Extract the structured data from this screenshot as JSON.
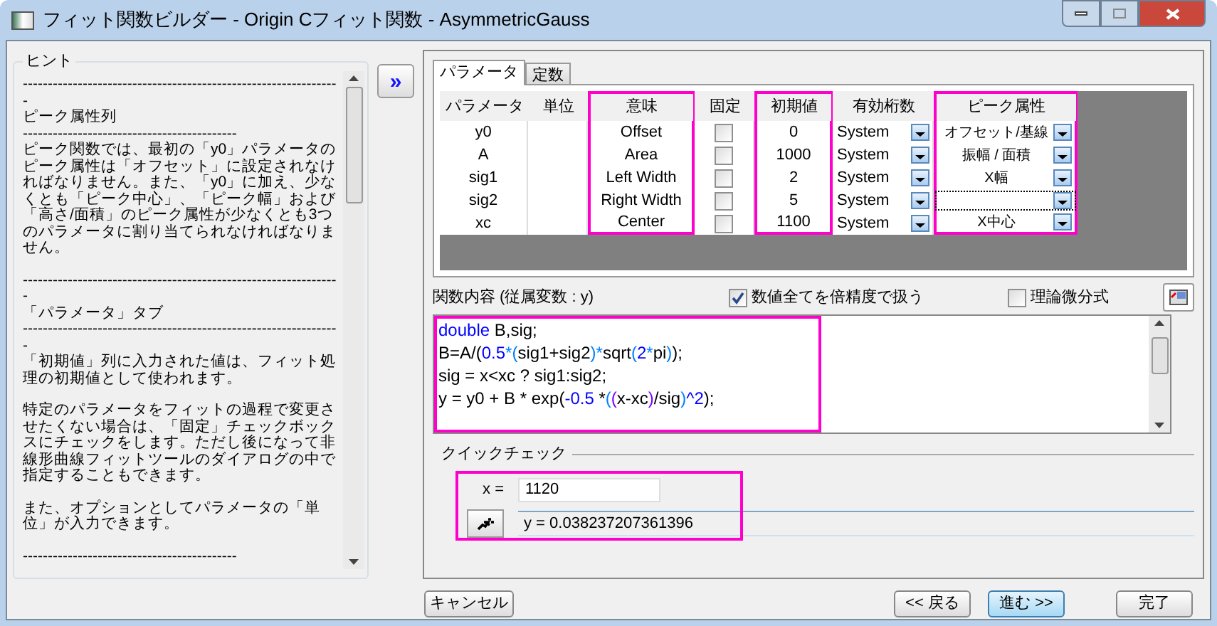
{
  "window": {
    "title": "フィット関数ビルダー - Origin Cフィット関数 - AsymmetricGauss"
  },
  "hint": {
    "title": "ヒント",
    "sections": [
      [
        "----------------------------------------------------------------",
        "ピーク属性列",
        "-------------------------------------------",
        "ピーク関数では、最初の「y0」パラメータのピーク属性は「オフセット」に設定されなければなりません。また、「y0」に加え、少なくとも「ピーク中心」、「ピーク幅」および「高さ/面積」のピーク属性が少なくとも3つのパラメータに割り当てられなければなりません。"
      ],
      [
        "----------------------------------------------------------------",
        "「パラメータ」タブ",
        "----------------------------------------------------------------",
        "「初期値」列に入力された値は、フィット処理の初期値として使われます。"
      ],
      [
        "特定のパラメータをフィットの過程で変更させたくない場合は、「固定」チェックボックスにチェックをします。ただし後になって非線形曲線フィットツールのダイアログの中で指定することもできます。"
      ],
      [
        "また、オプションとしてパラメータの「単位」が入力できます。"
      ],
      [
        "-------------------------------------------"
      ]
    ]
  },
  "expand_button": "»",
  "tabs": [
    {
      "label": "パラメータ",
      "selected": true
    },
    {
      "label": "定数",
      "selected": false
    }
  ],
  "table": {
    "columns": [
      {
        "label": "パラメータ",
        "highlighted": false
      },
      {
        "label": "単位",
        "highlighted": false
      },
      {
        "label": "意味",
        "highlighted": true
      },
      {
        "label": "固定",
        "highlighted": false
      },
      {
        "label": "初期値",
        "highlighted": true
      },
      {
        "label": "有効桁数",
        "highlighted": false
      },
      {
        "label": "ピーク属性",
        "highlighted": true
      }
    ],
    "rows": [
      {
        "name": "y0",
        "meaning": "Offset",
        "fixed": false,
        "initial": "0",
        "digits": "System",
        "peak": "オフセット/基線",
        "focused": false
      },
      {
        "name": "A",
        "meaning": "Area",
        "fixed": false,
        "initial": "1000",
        "digits": "System",
        "peak": "振幅 / 面積",
        "focused": false
      },
      {
        "name": "sig1",
        "meaning": "Left Width",
        "fixed": false,
        "initial": "2",
        "digits": "System",
        "peak": "X幅",
        "focused": false
      },
      {
        "name": "sig2",
        "meaning": "Right Width",
        "fixed": false,
        "initial": "5",
        "digits": "System",
        "focused": true
      },
      {
        "name": "xc",
        "meaning": "Center",
        "fixed": false,
        "initial": "1100",
        "digits": "System",
        "peak": "X中心",
        "focused": false
      }
    ]
  },
  "function_label": "関数内容 (従属変数 : y)",
  "options": [
    {
      "label": "数値全てを倍精度で扱う",
      "checked": true
    },
    {
      "label": "理論微分式",
      "checked": false
    }
  ],
  "code": {
    "highlighted": true,
    "lines": [
      [
        {
          "text": "double",
          "color": "#0000ff"
        },
        {
          "text": " B,sig;",
          "color": "#000000"
        }
      ],
      [
        {
          "text": "B=A/(",
          "color": "#000000"
        },
        {
          "text": "0.5",
          "color": "#0000ff"
        },
        {
          "text": "*(",
          "color": "#0080ff"
        },
        {
          "text": "sig1+sig2",
          "color": "#000000"
        },
        {
          "text": ")*",
          "color": "#0080ff"
        },
        {
          "text": "sqrt",
          "color": "#000000"
        },
        {
          "text": "(",
          "color": "#0080ff"
        },
        {
          "text": "2",
          "color": "#0000ff"
        },
        {
          "text": "*",
          "color": "#0080ff"
        },
        {
          "text": "pi",
          "color": "#000000"
        },
        {
          "text": ")",
          "color": "#0080ff"
        },
        {
          "text": ");",
          "color": "#000000"
        }
      ],
      [
        {
          "text": "sig = x<xc ? sig1:sig2;",
          "color": "#000000"
        }
      ],
      [
        {
          "text": "y = y0 + B * exp(",
          "color": "#000000"
        },
        {
          "text": "-0.5",
          "color": "#0000ff"
        },
        {
          "text": " *",
          "color": "#000000"
        },
        {
          "text": "(",
          "color": "#0080ff"
        },
        {
          "text": "(",
          "color": "#8000ff"
        },
        {
          "text": "x-xc",
          "color": "#000000"
        },
        {
          "text": ")",
          "color": "#8000ff"
        },
        {
          "text": "/sig",
          "color": "#000000"
        },
        {
          "text": ")",
          "color": "#0080ff"
        },
        {
          "text": "^2",
          "color": "#0000ff"
        },
        {
          "text": ");",
          "color": "#000000"
        }
      ]
    ]
  },
  "quick_check": {
    "title": "クイックチェック",
    "highlighted": true,
    "x_label": "x =",
    "x_value": "1120",
    "result": "y = 0.038237207361396"
  },
  "buttons": {
    "cancel": "キャンセル",
    "back": "<< 戻る",
    "next": "進む >>",
    "finish": "完了"
  }
}
